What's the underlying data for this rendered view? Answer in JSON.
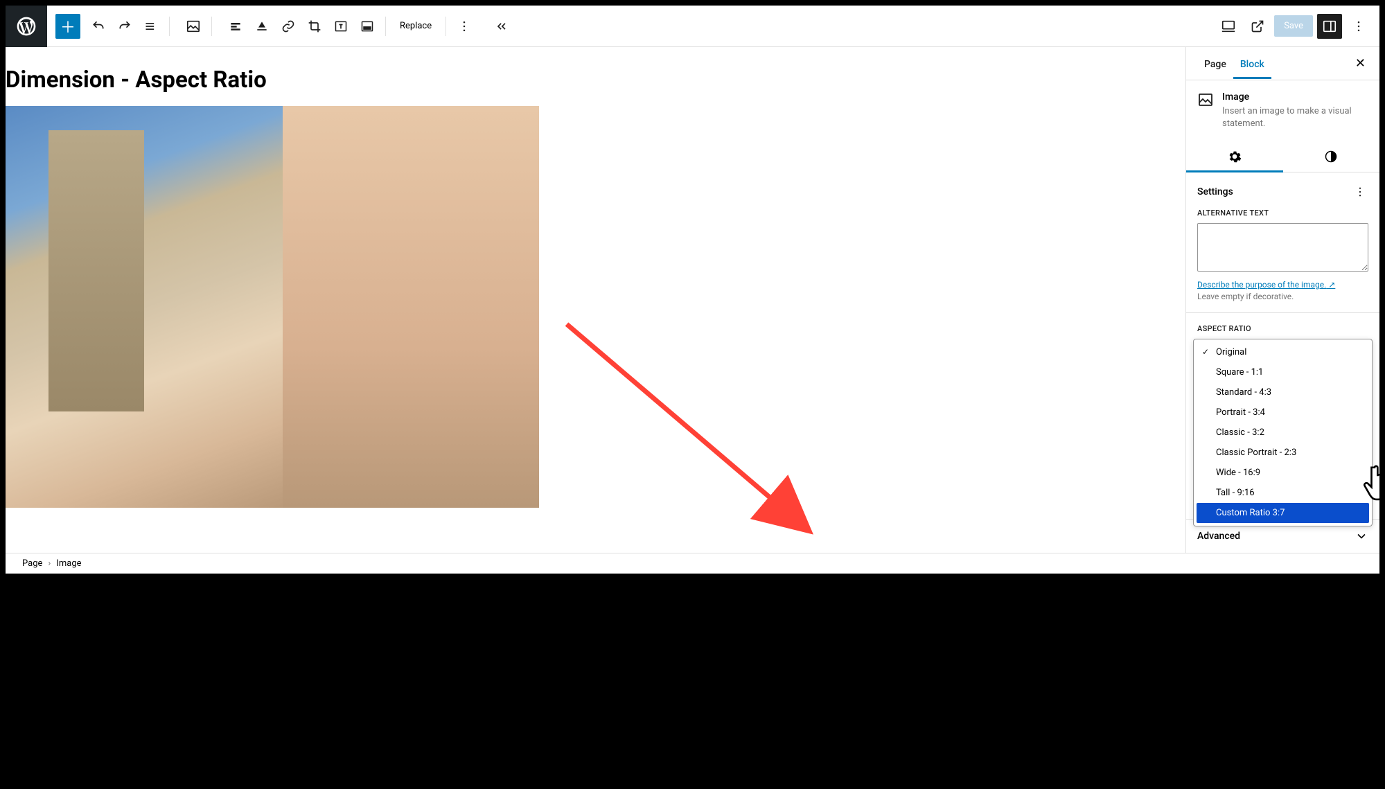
{
  "toolbar": {
    "replace_label": "Replace",
    "save_label": "Save"
  },
  "canvas": {
    "title": "Dimension - Aspect Ratio"
  },
  "sidebar": {
    "tabs": {
      "page": "Page",
      "block": "Block"
    },
    "block_name": "Image",
    "block_desc": "Insert an image to make a visual statement.",
    "settings_heading": "Settings",
    "alt_label": "ALTERNATIVE TEXT",
    "alt_link": "Describe the purpose of the image.",
    "alt_hint": "Leave empty if decorative.",
    "aspect_label": "ASPECT RATIO",
    "aspect_options": [
      "Original",
      "Square - 1:1",
      "Standard - 4:3",
      "Portrait - 3:4",
      "Classic - 3:2",
      "Classic Portrait - 2:3",
      "Wide - 16:9",
      "Tall - 9:16",
      "Custom Ratio 3:7"
    ],
    "aspect_selected_index": 0,
    "aspect_highlight_index": 8,
    "advanced_label": "Advanced"
  },
  "breadcrumb": {
    "root": "Page",
    "current": "Image"
  }
}
